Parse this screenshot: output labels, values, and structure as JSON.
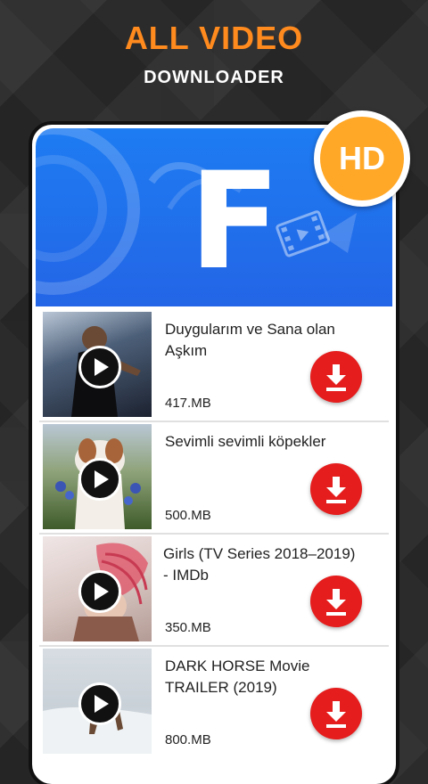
{
  "header": {
    "title": "ALL VIDEO",
    "subtitle": "DOWNLOADER"
  },
  "banner": {
    "letter": "F",
    "badge": "HD"
  },
  "colors": {
    "accent": "#ff8a1e",
    "banner_blue": "#1e7cf2",
    "download_red": "#e51d1d",
    "badge_orange": "#ffa726"
  },
  "videos": [
    {
      "title": "Duygularım ve Sana olan Aşkım",
      "size": "417.MB"
    },
    {
      "title": "Sevimli sevimli köpekler",
      "size": "500.MB"
    },
    {
      "title": "Girls (TV Series 2018–2019) - IMDb",
      "size": "350.MB"
    },
    {
      "title": "DARK HORSE Movie TRAILER (2019)",
      "size": "800.MB"
    }
  ],
  "icons": {
    "play": "play-icon",
    "download": "download-icon"
  }
}
